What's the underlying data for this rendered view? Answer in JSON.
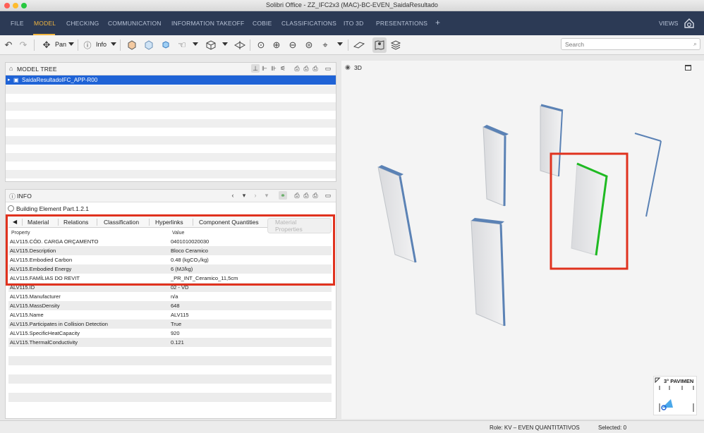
{
  "window": {
    "title": "Solibri Office - ZZ_IFC2x3 (MAC)-BC-EVEN_SaidaResultado"
  },
  "menu": {
    "items": [
      "FILE",
      "MODEL",
      "CHECKING",
      "COMMUNICATION",
      "INFORMATION TAKEOFF",
      "COBIE",
      "CLASSIFICATIONS",
      "ITO 3D",
      "PRESENTATIONS"
    ],
    "active": "MODEL",
    "add_label": "+",
    "views_label": "VIEWS"
  },
  "toolbar": {
    "pan_label": "Pan",
    "info_label": "Info",
    "search_placeholder": "Search"
  },
  "model_tree": {
    "title": "MODEL TREE",
    "selected_item": "SaidaResultadoIFC_APP-R00"
  },
  "info": {
    "title": "INFO",
    "element_title": "Building Element Part.1.2.1",
    "tabs": [
      "Material",
      "Relations",
      "Classification",
      "Hyperlinks",
      "Component Quantities",
      "Material Properties"
    ],
    "active_tab": "Material Properties",
    "columns": [
      "Property",
      "Value"
    ],
    "rows": [
      {
        "property": "ALV115.CÓD. CARGA ORÇAMENTO",
        "value": "0401010020030"
      },
      {
        "property": "ALV115.Description",
        "value": "Bloco Ceramico"
      },
      {
        "property": "ALV115.Embodied Carbon",
        "value": "0.48 (kgCO₂/kg)"
      },
      {
        "property": "ALV115.Embodied Energy",
        "value": "6 (MJ/kg)"
      },
      {
        "property": "ALV115.FAMÍLIAS DO REVIT",
        "value": "_PR_INT_Ceramico_11,5cm"
      },
      {
        "property": "ALV115.ID",
        "value": "02 - VD"
      },
      {
        "property": "ALV115.Manufacturer",
        "value": "n/a"
      },
      {
        "property": "ALV115.MassDensity",
        "value": "648"
      },
      {
        "property": "ALV115.Name",
        "value": "ALV115"
      },
      {
        "property": "ALV115.Participates in Collision Detection",
        "value": "True"
      },
      {
        "property": "ALV115.SpecificHeatCapacity",
        "value": "920"
      },
      {
        "property": "ALV115.ThermalConductivity",
        "value": "0.121"
      }
    ]
  },
  "view3d": {
    "title": "3D",
    "floor_label": "3° PAVIMEN"
  },
  "status": {
    "role": "Role: KV – EVEN QUANTITATIVOS",
    "selected": "Selected: 0"
  },
  "colors": {
    "menubar": "#2c3a55",
    "menu_active": "#f2b640",
    "selection": "#1f63d6",
    "highlight": "#e0321e",
    "selected_edge": "#1fba22",
    "wall_edge": "#5b82b5"
  }
}
